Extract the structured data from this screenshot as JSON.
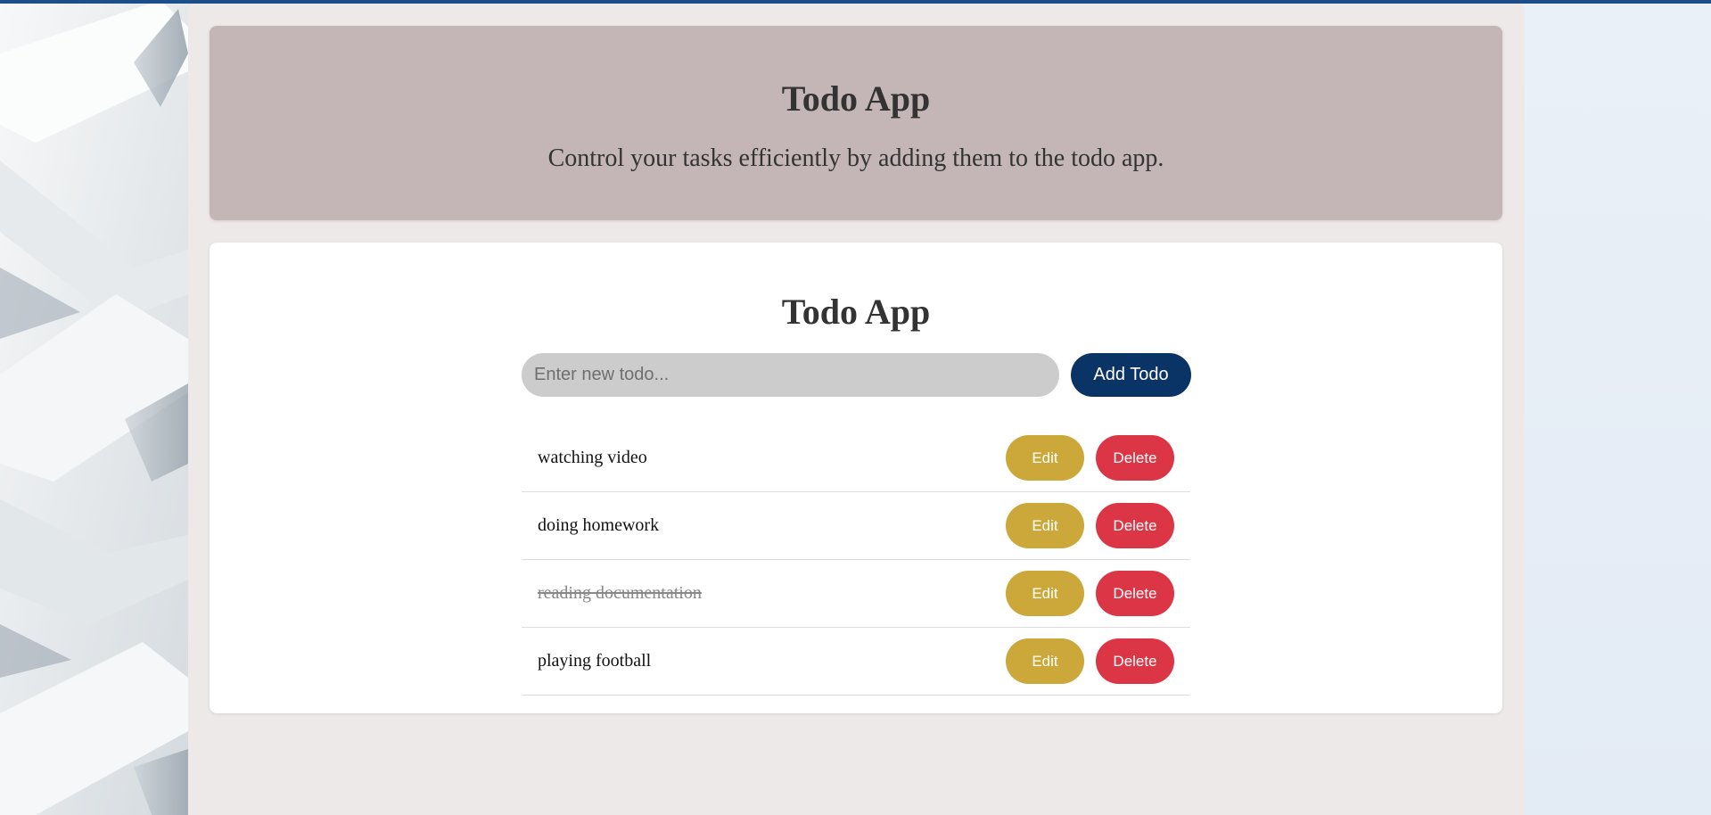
{
  "header": {
    "title": "Todo App",
    "subtitle": "Control your tasks efficiently by adding them to the todo app."
  },
  "main": {
    "title": "Todo App",
    "input_placeholder": "Enter new todo...",
    "input_value": "",
    "add_label": "Add Todo",
    "edit_label": "Edit",
    "delete_label": "Delete",
    "todos": [
      {
        "text": "watching video",
        "completed": false
      },
      {
        "text": "doing homework",
        "completed": false
      },
      {
        "text": "reading documentation",
        "completed": true
      },
      {
        "text": "playing football",
        "completed": false
      }
    ]
  },
  "colors": {
    "header_bg": "#c4b6b6",
    "add_button": "#0a3366",
    "edit_button": "#cca739",
    "delete_button": "#dc3545",
    "top_bar": "#1c4e8a"
  }
}
